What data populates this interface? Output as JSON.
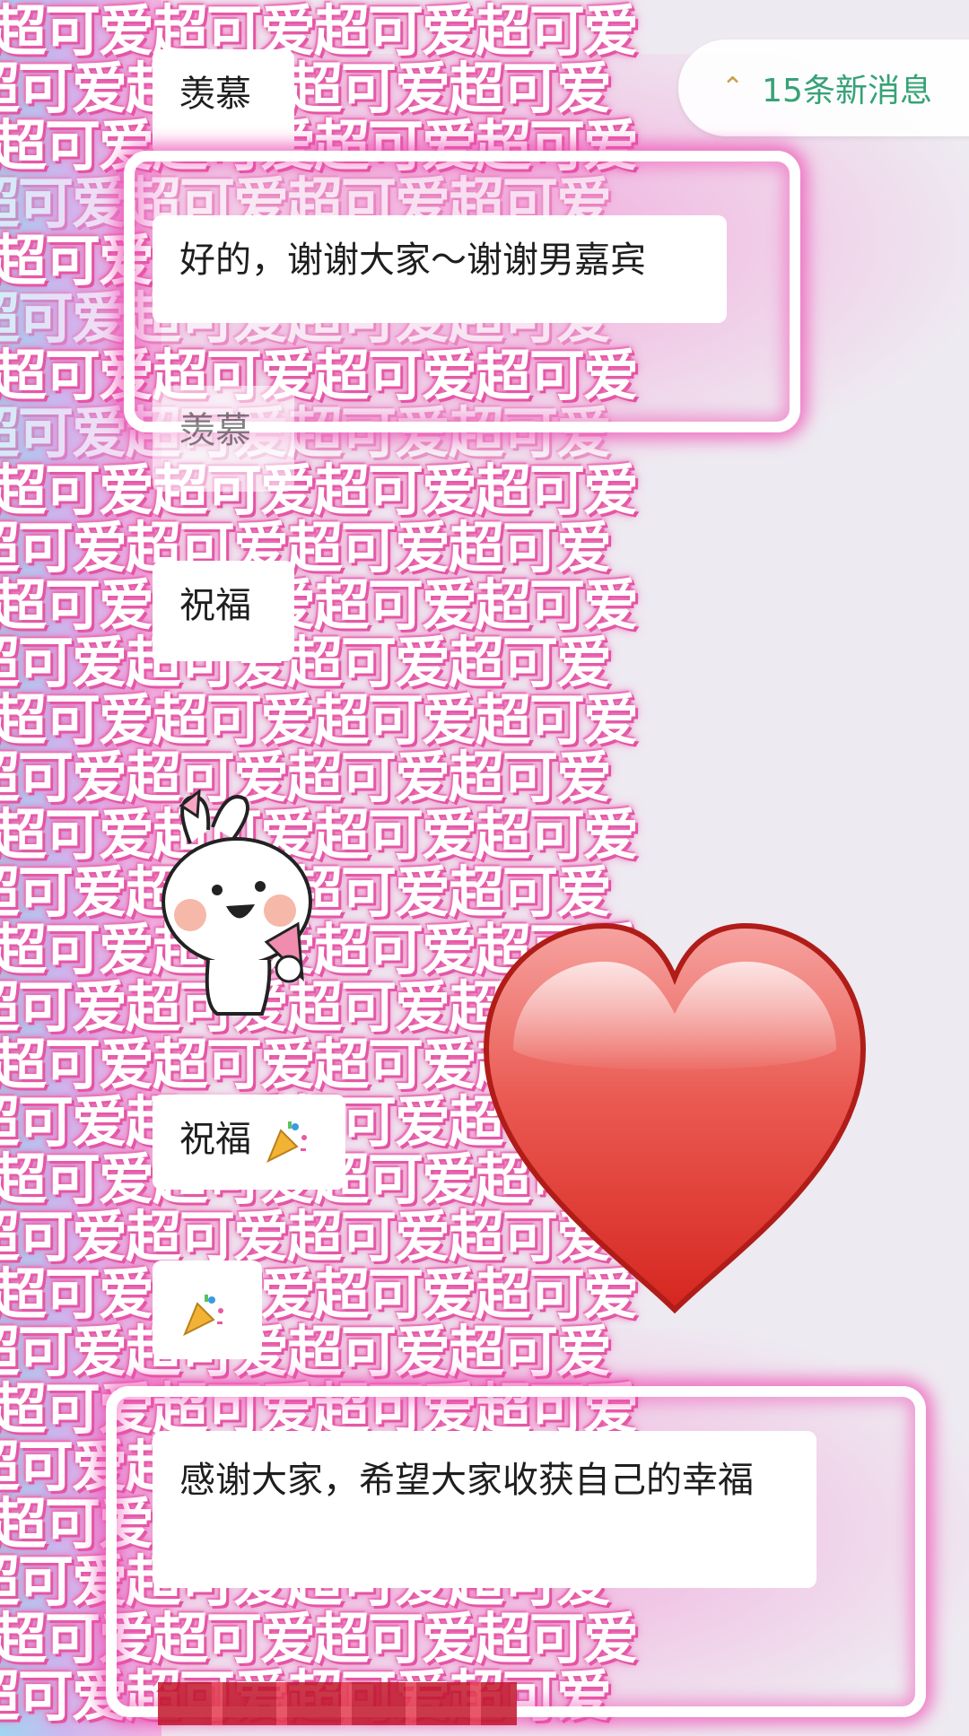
{
  "stickers": {
    "phrase": "超可爱超可爱超可爱超可爱"
  },
  "new_messages": {
    "label": "15条新消息",
    "icon": "double-chevron-up-icon"
  },
  "messages": [
    {
      "text": "羡慕"
    },
    {
      "text": "好的，谢谢大家～谢谢男嘉宾"
    },
    {
      "text": "羡慕"
    },
    {
      "text": "祝福"
    },
    {
      "sticker": "bunny-party-sticker"
    },
    {
      "text": "祝福",
      "emoji": "party-popper-icon"
    },
    {
      "emoji": "party-popper-icon"
    },
    {
      "text": "感谢大家，希望大家收获自己的幸福"
    }
  ],
  "colors": {
    "glow": "#ee50b4",
    "accent_green": "#36a277",
    "heart": "#e0312a"
  }
}
